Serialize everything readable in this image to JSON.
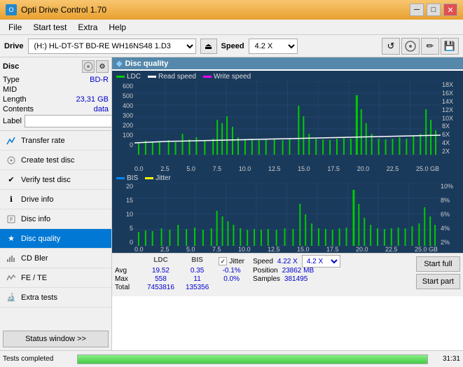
{
  "app": {
    "title": "Opti Drive Control 1.70",
    "icon": "●"
  },
  "titlebar": {
    "minimize": "─",
    "maximize": "□",
    "close": "✕"
  },
  "menu": {
    "items": [
      "File",
      "Start test",
      "Extra",
      "Help"
    ]
  },
  "drive_bar": {
    "label": "Drive",
    "drive_value": "(H:) HL-DT-ST BD-RE WH16NS48 1.D3",
    "eject_icon": "⏏",
    "speed_label": "Speed",
    "speed_value": "4.2 X",
    "toolbar_icons": [
      "↺",
      "💿",
      "✏",
      "💾"
    ]
  },
  "disc": {
    "title": "Disc",
    "icons": [
      "💿",
      "⚙"
    ],
    "type_label": "Type",
    "type_value": "BD-R",
    "mid_label": "MID",
    "mid_value": "",
    "length_label": "Length",
    "length_value": "23,31 GB",
    "contents_label": "Contents",
    "contents_value": "data",
    "label_label": "Label",
    "label_placeholder": ""
  },
  "nav": {
    "items": [
      {
        "id": "transfer-rate",
        "label": "Transfer rate",
        "icon": "📈"
      },
      {
        "id": "create-test-disc",
        "label": "Create test disc",
        "icon": "💿"
      },
      {
        "id": "verify-test-disc",
        "label": "Verify test disc",
        "icon": "✔"
      },
      {
        "id": "drive-info",
        "label": "Drive info",
        "icon": "ℹ"
      },
      {
        "id": "disc-info",
        "label": "Disc info",
        "icon": "📋"
      },
      {
        "id": "disc-quality",
        "label": "Disc quality",
        "icon": "★",
        "active": true
      },
      {
        "id": "cd-bler",
        "label": "CD Bler",
        "icon": "📊"
      },
      {
        "id": "fe-te",
        "label": "FE / TE",
        "icon": "📉"
      },
      {
        "id": "extra-tests",
        "label": "Extra tests",
        "icon": "🔬"
      }
    ],
    "status_btn": "Status window >>"
  },
  "chart": {
    "title": "Disc quality",
    "title_icon": "◆",
    "legend": {
      "ldc_label": "LDC",
      "ldc_color": "#00cc00",
      "read_label": "Read speed",
      "read_color": "#ffffff",
      "write_label": "Write speed",
      "write_color": "#ff00ff"
    },
    "upper": {
      "y_left": [
        "600",
        "500",
        "400",
        "300",
        "200",
        "100",
        "0"
      ],
      "y_right": [
        "18X",
        "16X",
        "14X",
        "12X",
        "10X",
        "8X",
        "6X",
        "4X",
        "2X"
      ],
      "x_labels": [
        "0.0",
        "2.5",
        "5.0",
        "7.5",
        "10.0",
        "12.5",
        "15.0",
        "17.5",
        "20.0",
        "22.5",
        "25.0 GB"
      ]
    },
    "lower": {
      "legend": {
        "bis_label": "BIS",
        "bis_color": "#0088ff",
        "jitter_label": "Jitter",
        "jitter_color": "#ffff00"
      },
      "y_left": [
        "20",
        "15",
        "10",
        "5",
        "0"
      ],
      "y_right": [
        "10%",
        "8%",
        "6%",
        "4%",
        "2%"
      ],
      "x_labels": [
        "0.0",
        "2.5",
        "5.0",
        "7.5",
        "10.0",
        "12.5",
        "15.0",
        "17.5",
        "20.0",
        "22.5",
        "25.0 GB"
      ]
    }
  },
  "stats": {
    "col_ldc_header": "LDC",
    "col_bis_header": "BIS",
    "col_jitter_header": "Jitter",
    "avg_label": "Avg",
    "max_label": "Max",
    "total_label": "Total",
    "ldc_avg": "19.52",
    "ldc_max": "558",
    "ldc_total": "7453816",
    "bis_avg": "0.35",
    "bis_max": "11",
    "bis_total": "135356",
    "jitter_label": "Jitter",
    "jitter_avg": "-0.1%",
    "jitter_max": "0.0%",
    "jitter_total": "",
    "jitter_checked": "✓",
    "speed_label": "Speed",
    "speed_value": "4.22 X",
    "speed_dropdown": "4.2 X",
    "position_label": "Position",
    "position_value": "23862 MB",
    "samples_label": "Samples",
    "samples_value": "381495",
    "btn_start_full": "Start full",
    "btn_start_part": "Start part"
  },
  "progress": {
    "label": "Tests completed",
    "percent": 100,
    "time": "31:31"
  },
  "colors": {
    "accent": "#0078d4",
    "chart_bg": "#1a3a5c",
    "chart_grid": "#2a4a7c",
    "ldc_bar": "#00cc00",
    "speed_line": "#ffffff",
    "bis_bar": "#0088ff",
    "jitter_bar": "#ffff00"
  }
}
